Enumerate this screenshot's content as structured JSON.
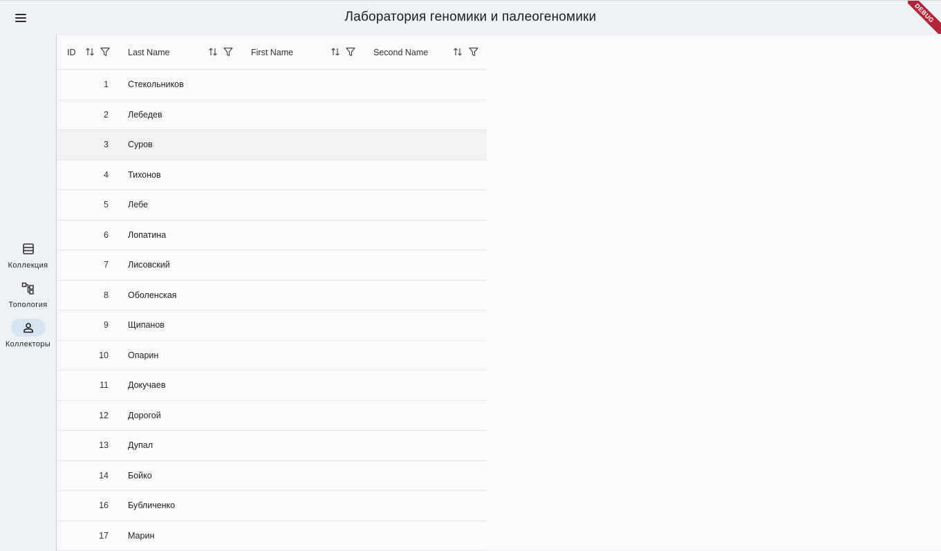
{
  "app": {
    "title": "Лаборатория геномики и палеогеномики",
    "debug_banner": "DEBUG"
  },
  "rail": {
    "items": [
      {
        "label": "Коллекция",
        "icon": "table-icon"
      },
      {
        "label": "Топология",
        "icon": "topology-icon"
      },
      {
        "label": "Коллекторы",
        "icon": "person-icon",
        "active": true
      }
    ]
  },
  "table": {
    "columns": [
      "ID",
      "Last Name",
      "First Name",
      "Second Name"
    ],
    "rows": [
      {
        "id": "1",
        "last_name": "Стекольников"
      },
      {
        "id": "2",
        "last_name": "Лебедев"
      },
      {
        "id": "3",
        "last_name": "Суров"
      },
      {
        "id": "4",
        "last_name": "Тихонов"
      },
      {
        "id": "5",
        "last_name": "Лебе"
      },
      {
        "id": "6",
        "last_name": "Лопатина"
      },
      {
        "id": "7",
        "last_name": "Лисовский"
      },
      {
        "id": "8",
        "last_name": "Оболенская"
      },
      {
        "id": "9",
        "last_name": "Щипанов"
      },
      {
        "id": "10",
        "last_name": "Опарин"
      },
      {
        "id": "11",
        "last_name": "Докучаев"
      },
      {
        "id": "12",
        "last_name": "Дорогой"
      },
      {
        "id": "13",
        "last_name": "Дупал"
      },
      {
        "id": "14",
        "last_name": "Бойко"
      },
      {
        "id": "16",
        "last_name": "Бубличенко"
      },
      {
        "id": "17",
        "last_name": "Марин"
      }
    ]
  }
}
